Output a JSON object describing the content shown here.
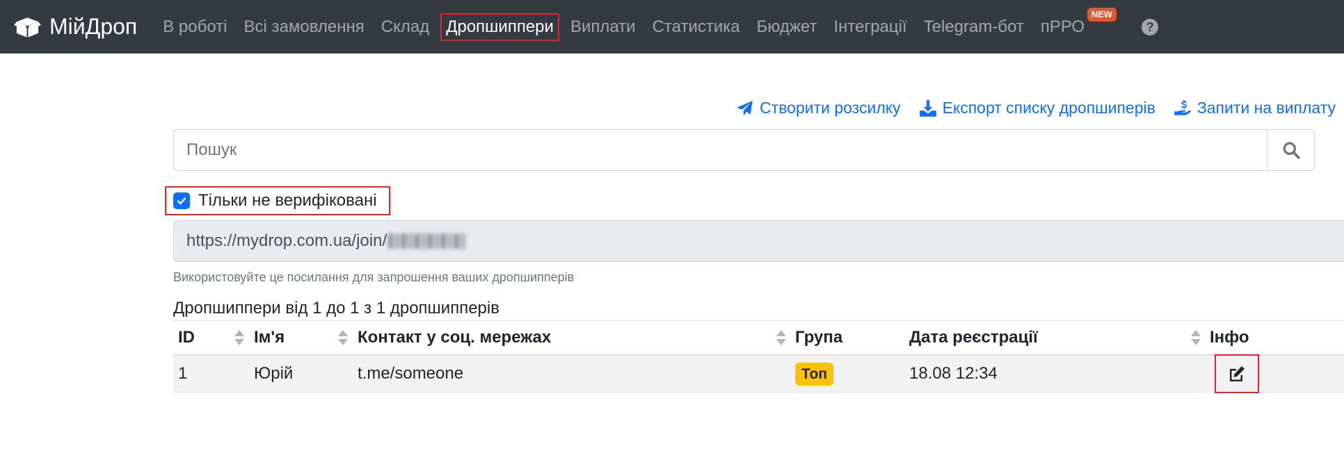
{
  "navbar": {
    "brand": "МійДроп",
    "items": [
      {
        "label": "В роботі"
      },
      {
        "label": "Всі замовлення"
      },
      {
        "label": "Склад"
      },
      {
        "label": "Дропшиппери",
        "active": true
      },
      {
        "label": "Виплати"
      },
      {
        "label": "Статистика"
      },
      {
        "label": "Бюджет"
      },
      {
        "label": "Інтеграції"
      },
      {
        "label": "Telegram-бот"
      },
      {
        "label": "пРРО",
        "badge": "NEW"
      }
    ],
    "help_icon": "question-circle-icon"
  },
  "actions": {
    "newsletter": "Створити розсилку",
    "export": "Експорт списку дропшиперів",
    "payout_requests": "Запити на виплату"
  },
  "search": {
    "placeholder": "Пошук",
    "value": ""
  },
  "filter": {
    "label": "Тільки не верифіковані",
    "checked": true
  },
  "invite": {
    "url_visible": "https://mydrop.com.ua/join/",
    "hint": "Використовуйте це посилання для запрошення ваших дропшипперів"
  },
  "table": {
    "count_text": "Дропшиппери від 1 до 1 з 1 дропшипперів",
    "columns": {
      "id": "ID",
      "name": "Ім'я",
      "contact": "Контакт у соц. мережах",
      "group": "Група",
      "registered": "Дата реєстрації",
      "info": "Інфо"
    },
    "rows": [
      {
        "id": "1",
        "name": "Юрій",
        "contact": "t.me/someone",
        "group": "Топ",
        "registered": "18.08 12:34"
      }
    ]
  },
  "colors": {
    "navbar_bg": "#343a40",
    "link": "#0d6efd",
    "highlight_outline": "#e3232c",
    "badge_group": "#ffc107",
    "badge_new": "#e8562c"
  }
}
